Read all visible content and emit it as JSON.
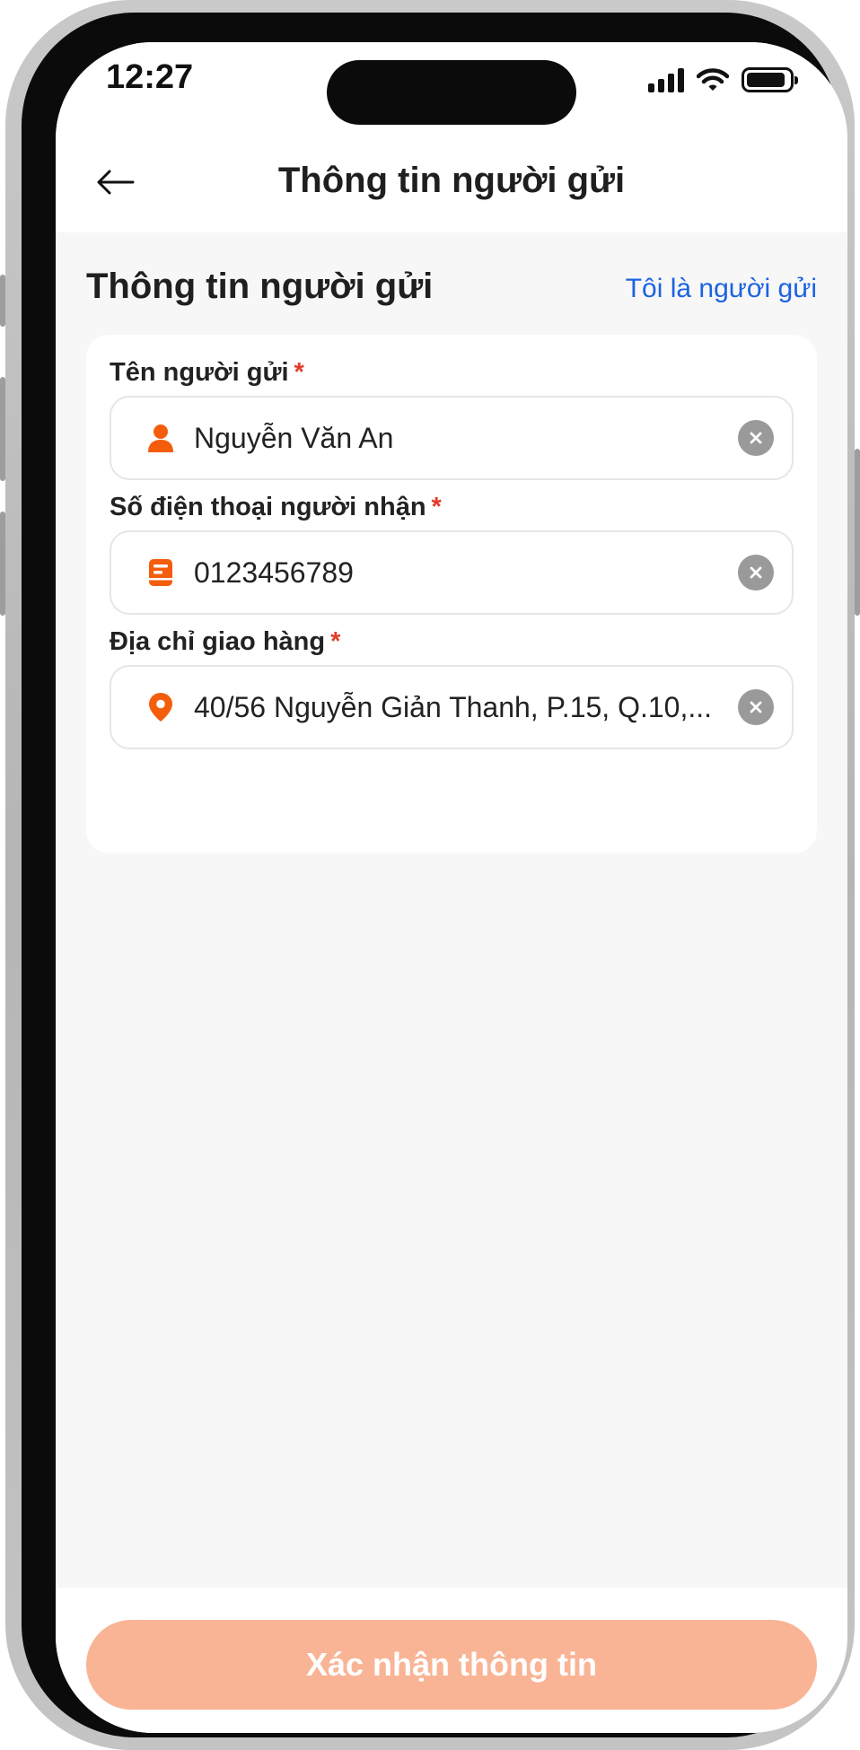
{
  "status_bar": {
    "time": "12:27"
  },
  "header": {
    "title": "Thông tin người gửi",
    "back_icon": "arrow-left-icon"
  },
  "section": {
    "title": "Thông tin người gửi",
    "self_sender_link": "Tôi là người gửi"
  },
  "form": {
    "fields": [
      {
        "label": "Tên người gửi",
        "required_mark": "*",
        "value": "Nguyễn Văn An",
        "icon": "user-icon"
      },
      {
        "label": "Số điện thoại người nhận",
        "required_mark": "*",
        "value": "0123456789",
        "icon": "phone-book-icon"
      },
      {
        "label": "Địa chỉ giao hàng",
        "required_mark": "*",
        "value": "40/56 Nguyễn Giản Thanh, P.15, Q.10,...",
        "icon": "location-pin-icon"
      }
    ]
  },
  "footer": {
    "confirm_label": "Xác nhận thông tin"
  },
  "colors": {
    "accent": "#f45d0c",
    "link": "#1b63e0",
    "required": "#e23a2a",
    "button_disabled": "#f9b496",
    "background": "#f7f7f7"
  }
}
